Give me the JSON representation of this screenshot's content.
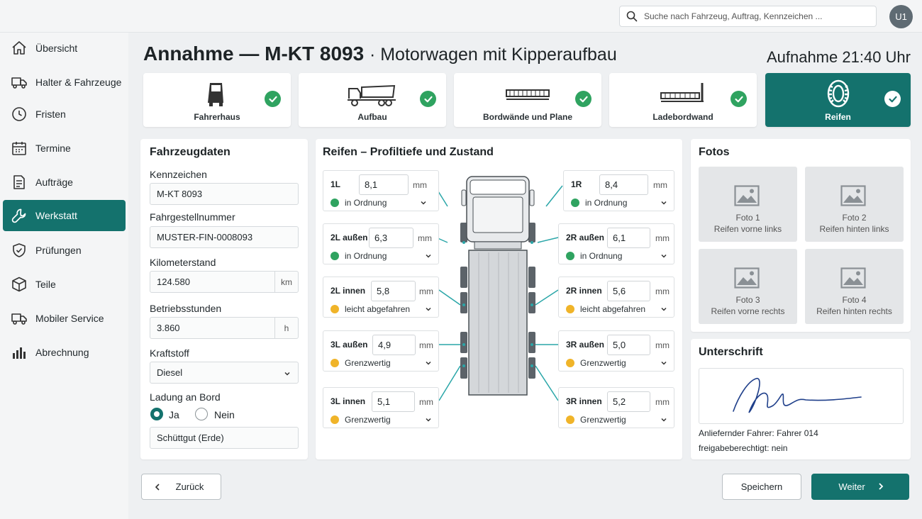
{
  "search": {
    "placeholder": "Suche nach Fahrzeug, Auftrag, Kennzeichen ..."
  },
  "user": {
    "initials": "U1"
  },
  "sidebar": {
    "items": [
      {
        "label": "Übersicht",
        "icon": "home-icon"
      },
      {
        "label": "Halter & Fahrzeuge",
        "icon": "truck-icon"
      },
      {
        "label": "Fristen",
        "icon": "clock-icon"
      },
      {
        "label": "Termine",
        "icon": "calendar-icon"
      },
      {
        "label": "Aufträge",
        "icon": "document-icon"
      },
      {
        "label": "Werkstatt",
        "icon": "wrench-icon",
        "active": true
      },
      {
        "label": "Prüfungen",
        "icon": "shield-check-icon"
      },
      {
        "label": "Teile",
        "icon": "box-icon"
      },
      {
        "label": "Mobiler Service",
        "icon": "truck-icon"
      },
      {
        "label": "Abrechnung",
        "icon": "bar-chart-icon"
      }
    ]
  },
  "header": {
    "title_main": "Annahme — M-KT 8093",
    "title_sub": "· Motorwagen mit Kipperaufbau",
    "aufnahme_label": "Aufnahme",
    "aufnahme_time": "21:40 Uhr"
  },
  "steps": [
    {
      "label": "Fahrerhaus",
      "done": true
    },
    {
      "label": "Aufbau",
      "done": true
    },
    {
      "label": "Bordwände und Plane",
      "done": true
    },
    {
      "label": "Ladebordwand",
      "done": true
    },
    {
      "label": "Reifen",
      "done": true,
      "active": true
    }
  ],
  "vehicle": {
    "title": "Fahrzeugdaten",
    "kennzeichen_label": "Kennzeichen",
    "kennzeichen": "M-KT 8093",
    "fin_label": "Fahrgestellnummer",
    "fin": "MUSTER-FIN-0008093",
    "km_label": "Kilometerstand",
    "km": "124.580",
    "km_unit": "km",
    "hours_label": "Betriebsstunden",
    "hours": "3.860",
    "hours_unit": "h",
    "fuel_label": "Kraftstoff",
    "fuel": "Diesel",
    "load_label": "Ladung an Bord",
    "load_yes": "Ja",
    "load_no": "Nein",
    "load_selected": "Ja",
    "load_text": "Schüttgut (Erde)"
  },
  "tires": {
    "title": "Reifen – Profiltiefe und Zustand",
    "unit": "mm",
    "colors": {
      "ok": "#2fa360",
      "warn": "#f0b429"
    },
    "left": [
      {
        "pos": "1L",
        "depth": "8,1",
        "status": "in Ordnung",
        "level": "ok"
      },
      {
        "pos": "2L außen",
        "depth": "6,3",
        "status": "in Ordnung",
        "level": "ok"
      },
      {
        "pos": "2L innen",
        "depth": "5,8",
        "status": "leicht abgefahren",
        "level": "warn"
      },
      {
        "pos": "3L außen",
        "depth": "4,9",
        "status": "Grenzwertig",
        "level": "warn"
      },
      {
        "pos": "3L innen",
        "depth": "5,1",
        "status": "Grenzwertig",
        "level": "warn"
      }
    ],
    "right": [
      {
        "pos": "1R",
        "depth": "8,4",
        "status": "in Ordnung",
        "level": "ok"
      },
      {
        "pos": "2R außen",
        "depth": "6,1",
        "status": "in Ordnung",
        "level": "ok"
      },
      {
        "pos": "2R innen",
        "depth": "5,6",
        "status": "leicht abgefahren",
        "level": "warn"
      },
      {
        "pos": "3R außen",
        "depth": "5,0",
        "status": "Grenzwertig",
        "level": "warn"
      },
      {
        "pos": "3R innen",
        "depth": "5,2",
        "status": "Grenzwertig",
        "level": "warn"
      }
    ]
  },
  "photos": {
    "title": "Fotos",
    "items": [
      {
        "name": "Foto 1",
        "caption": "Reifen vorne links"
      },
      {
        "name": "Foto 2",
        "caption": "Reifen hinten links"
      },
      {
        "name": "Foto 3",
        "caption": "Reifen vorne rechts"
      },
      {
        "name": "Foto 4",
        "caption": "Reifen hinten rechts"
      }
    ]
  },
  "signature": {
    "title": "Unterschrift",
    "driver_label": "Anliefernder Fahrer:",
    "driver": "Fahrer 014",
    "authorized": "freigabeberechtigt: nein"
  },
  "actions": {
    "back": "Zurück",
    "save": "Speichern",
    "next": "Weiter"
  }
}
